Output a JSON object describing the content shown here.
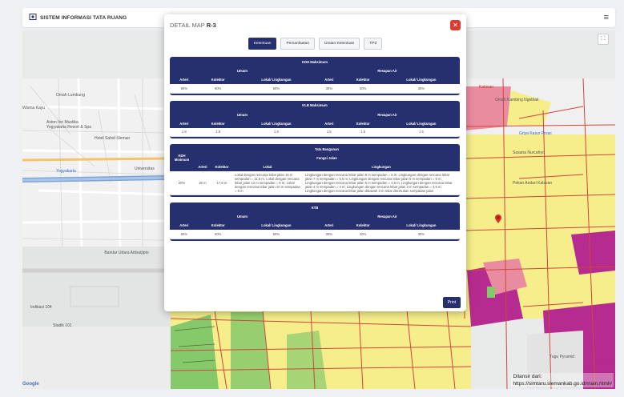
{
  "app": {
    "title": "SISTEM INFORMASI TATA RUANG"
  },
  "map": {
    "labels": [
      "Omah Lumbung",
      "Wisma Kayu",
      "Aston Inn Mustika Yogyakarta Resort & Spa",
      "Hotel Sahid Sleman",
      "Yogyakarta",
      "Universitas",
      "Bandar Udara Adisutjipto",
      "Stadik 101",
      "Indikasi 104",
      "Tugu Pyramid",
      "Gudang Ayam Ngebrak",
      "Toko Daging Sapi"
    ],
    "right_labels": [
      "Kalasan",
      "Omah Kambing Ngeblak",
      "Toko Dingin",
      "Griya Kasur Proac",
      "Sasana Nurcahyo",
      "Pekan Andari Kalasan",
      "Nirmala Nursa Villa"
    ],
    "fullscreen_icon": "expand-icon",
    "google": "Google",
    "source_line1": "Dilansir dari:",
    "source_line2": "https://simtaru.slemankab.go.id/main.html#",
    "colors": {
      "residential": "#f5ee8a",
      "green": "#86c96b",
      "pink": "#e98ca0",
      "magenta": "#b52b8f",
      "road_red": "#d0463b"
    }
  },
  "modal": {
    "title_prefix": "DETAIL MAP",
    "title_code": "R-3",
    "tabs": [
      "Ketentuan",
      "Pemanfaatan",
      "Uraian Ketentuan",
      "TPZ"
    ],
    "active_tab": "Ketentuan",
    "print_label": "Print",
    "kdh": {
      "title": "KDH Maksimum",
      "group_umum": "Umum",
      "group_resapan": "Resapan Air",
      "cols": [
        "Arteri",
        "Kolektor",
        "Lokal/ Lingkungan",
        "Arteri",
        "Kolektor",
        "Lokal/ Lingkungan"
      ],
      "values": [
        "60%",
        "60%",
        "60%",
        "30%",
        "30%",
        "30%"
      ]
    },
    "klb": {
      "title": "KLB Maksimum",
      "group_umum": "Umum",
      "group_resapan": "Resapan Air",
      "cols": [
        "Arteri",
        "Kolektor",
        "Lokal/ Lingkungan",
        "Arteri",
        "Kolektor",
        "Lokal/ Lingkungan"
      ],
      "values": [
        "1.8",
        "1.8",
        "1.8",
        "1.5",
        "1.5",
        "1.5"
      ]
    },
    "tata": {
      "title": "Tata Bangunan",
      "kdh_header": "KDH Minimum",
      "fungsi_jalan": "Fungsi Jalan",
      "cols": [
        "Arteri",
        "Kolektor",
        "Lokal",
        "Lingkungan"
      ],
      "kdh_value": "20%",
      "arteri": "20 m",
      "kolektor": "17,5 m",
      "lokal": "Lokal dengan rencana lebar jalan 15 m sempadan = 11,5 m, Lokal dengan rencana lebar jalan 12 m sempadan = 8 m, Lokal dengan rencana lebar jalan 10 m sempadan = 8 m",
      "lingkungan": "Lingkungan dengan rencana lebar jalan 8 m sempadan = 6 m; Lingkungan dengan rencana lebar jalan 7 m sempadan = 5,5 m; Lingkungan dengan rencana lebar jalan 6 m sempadan = 5 m; Lingkungan dengan rencana lebar jalan 5 m sempadan = 4,5 m, Lingkungan dengan rencana lebar jalan 4 m sempadan = 4 m; Lingkungan dengan rencana lebar jalan 3 m sempadan = 3,5 m; Lingkungan dengan rencana lebar jalan dibawah 3 m lebar ditentukan sempadan jalan"
    },
    "ktb": {
      "title": "KTB",
      "group_umum": "Umum",
      "group_resapan": "Resapan Air",
      "cols": [
        "Arteri",
        "Kolektor",
        "Lokal/ Lingkungan",
        "Arteri",
        "Kolektor",
        "Lokal/ Lingkungan"
      ],
      "values": [
        "60%",
        "60%",
        "60%",
        "30%",
        "30%",
        "30%"
      ]
    }
  }
}
